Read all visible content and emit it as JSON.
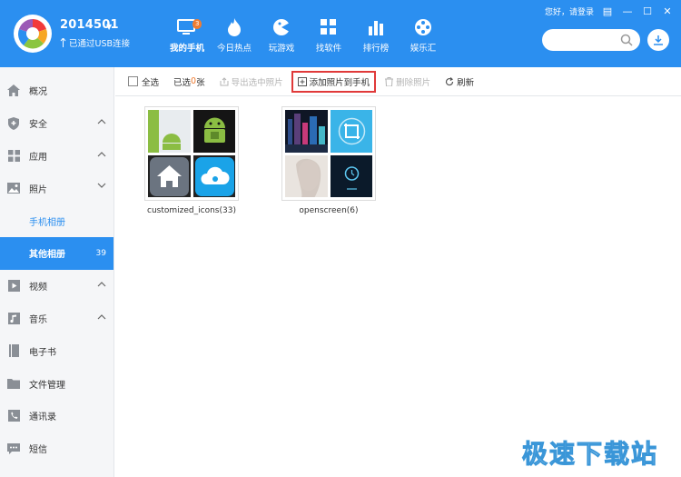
{
  "device": {
    "name": "2014501",
    "status": "已通过USB连接"
  },
  "nav": [
    {
      "label": "我的手机",
      "icon": "phone-icon",
      "active": true,
      "badge": "3"
    },
    {
      "label": "今日热点",
      "icon": "flame-icon"
    },
    {
      "label": "玩游戏",
      "icon": "game-icon"
    },
    {
      "label": "找软件",
      "icon": "apps-icon"
    },
    {
      "label": "排行榜",
      "icon": "chart-icon"
    },
    {
      "label": "娱乐汇",
      "icon": "film-reel-icon"
    }
  ],
  "topbar": {
    "login_text": "您好，请登录",
    "search_placeholder": ""
  },
  "sidebar": {
    "items": [
      {
        "label": "概况",
        "icon": "home-icon"
      },
      {
        "label": "安全",
        "icon": "shield-icon"
      },
      {
        "label": "应用",
        "icon": "apps-grid-icon"
      },
      {
        "label": "照片",
        "icon": "photo-icon"
      },
      {
        "label": "手机相册"
      },
      {
        "label": "其他相册",
        "count": "39"
      },
      {
        "label": "视频",
        "icon": "video-icon"
      },
      {
        "label": "音乐",
        "icon": "music-icon"
      },
      {
        "label": "电子书",
        "icon": "book-icon"
      },
      {
        "label": "文件管理",
        "icon": "folder-icon"
      },
      {
        "label": "通讯录",
        "icon": "contacts-icon"
      },
      {
        "label": "短信",
        "icon": "sms-icon"
      }
    ]
  },
  "toolbar": {
    "select_all": "全选",
    "selected_prefix": "已选",
    "selected_count": "0",
    "selected_suffix": "张",
    "export": "导出选中照片",
    "add": "添加照片到手机",
    "delete": "删除照片",
    "refresh": "刷新"
  },
  "albums": [
    {
      "name": "customized_icons(33)"
    },
    {
      "name": "openscreen(6)"
    }
  ],
  "watermark": "极速下载站",
  "colors": {
    "accent": "#2b8ff0",
    "badge": "#f07c31",
    "highlight": "#e03a3a"
  }
}
